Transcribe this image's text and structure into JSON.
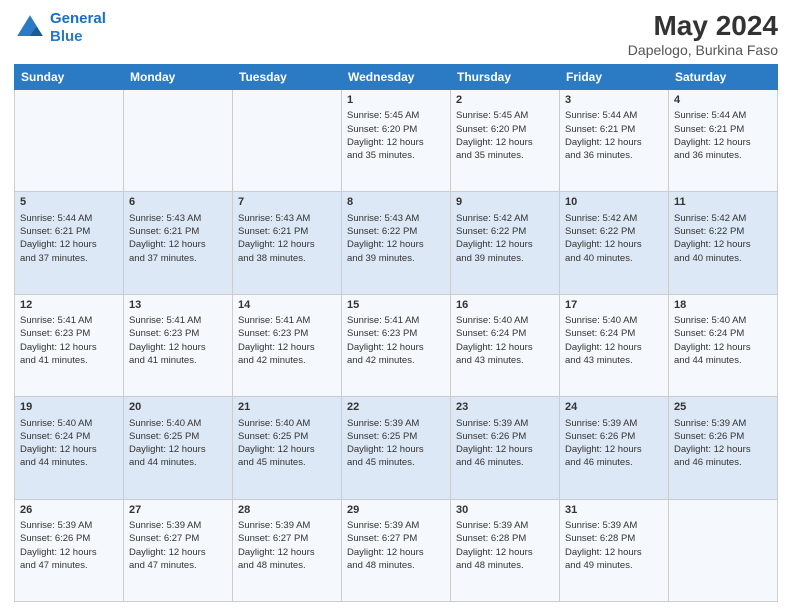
{
  "logo": {
    "line1": "General",
    "line2": "Blue"
  },
  "title": "May 2024",
  "subtitle": "Dapelogo, Burkina Faso",
  "columns": [
    "Sunday",
    "Monday",
    "Tuesday",
    "Wednesday",
    "Thursday",
    "Friday",
    "Saturday"
  ],
  "weeks": [
    [
      {
        "day": "",
        "info": ""
      },
      {
        "day": "",
        "info": ""
      },
      {
        "day": "",
        "info": ""
      },
      {
        "day": "1",
        "info": "Sunrise: 5:45 AM\nSunset: 6:20 PM\nDaylight: 12 hours\nand 35 minutes."
      },
      {
        "day": "2",
        "info": "Sunrise: 5:45 AM\nSunset: 6:20 PM\nDaylight: 12 hours\nand 35 minutes."
      },
      {
        "day": "3",
        "info": "Sunrise: 5:44 AM\nSunset: 6:21 PM\nDaylight: 12 hours\nand 36 minutes."
      },
      {
        "day": "4",
        "info": "Sunrise: 5:44 AM\nSunset: 6:21 PM\nDaylight: 12 hours\nand 36 minutes."
      }
    ],
    [
      {
        "day": "5",
        "info": "Sunrise: 5:44 AM\nSunset: 6:21 PM\nDaylight: 12 hours\nand 37 minutes."
      },
      {
        "day": "6",
        "info": "Sunrise: 5:43 AM\nSunset: 6:21 PM\nDaylight: 12 hours\nand 37 minutes."
      },
      {
        "day": "7",
        "info": "Sunrise: 5:43 AM\nSunset: 6:21 PM\nDaylight: 12 hours\nand 38 minutes."
      },
      {
        "day": "8",
        "info": "Sunrise: 5:43 AM\nSunset: 6:22 PM\nDaylight: 12 hours\nand 39 minutes."
      },
      {
        "day": "9",
        "info": "Sunrise: 5:42 AM\nSunset: 6:22 PM\nDaylight: 12 hours\nand 39 minutes."
      },
      {
        "day": "10",
        "info": "Sunrise: 5:42 AM\nSunset: 6:22 PM\nDaylight: 12 hours\nand 40 minutes."
      },
      {
        "day": "11",
        "info": "Sunrise: 5:42 AM\nSunset: 6:22 PM\nDaylight: 12 hours\nand 40 minutes."
      }
    ],
    [
      {
        "day": "12",
        "info": "Sunrise: 5:41 AM\nSunset: 6:23 PM\nDaylight: 12 hours\nand 41 minutes."
      },
      {
        "day": "13",
        "info": "Sunrise: 5:41 AM\nSunset: 6:23 PM\nDaylight: 12 hours\nand 41 minutes."
      },
      {
        "day": "14",
        "info": "Sunrise: 5:41 AM\nSunset: 6:23 PM\nDaylight: 12 hours\nand 42 minutes."
      },
      {
        "day": "15",
        "info": "Sunrise: 5:41 AM\nSunset: 6:23 PM\nDaylight: 12 hours\nand 42 minutes."
      },
      {
        "day": "16",
        "info": "Sunrise: 5:40 AM\nSunset: 6:24 PM\nDaylight: 12 hours\nand 43 minutes."
      },
      {
        "day": "17",
        "info": "Sunrise: 5:40 AM\nSunset: 6:24 PM\nDaylight: 12 hours\nand 43 minutes."
      },
      {
        "day": "18",
        "info": "Sunrise: 5:40 AM\nSunset: 6:24 PM\nDaylight: 12 hours\nand 44 minutes."
      }
    ],
    [
      {
        "day": "19",
        "info": "Sunrise: 5:40 AM\nSunset: 6:24 PM\nDaylight: 12 hours\nand 44 minutes."
      },
      {
        "day": "20",
        "info": "Sunrise: 5:40 AM\nSunset: 6:25 PM\nDaylight: 12 hours\nand 44 minutes."
      },
      {
        "day": "21",
        "info": "Sunrise: 5:40 AM\nSunset: 6:25 PM\nDaylight: 12 hours\nand 45 minutes."
      },
      {
        "day": "22",
        "info": "Sunrise: 5:39 AM\nSunset: 6:25 PM\nDaylight: 12 hours\nand 45 minutes."
      },
      {
        "day": "23",
        "info": "Sunrise: 5:39 AM\nSunset: 6:26 PM\nDaylight: 12 hours\nand 46 minutes."
      },
      {
        "day": "24",
        "info": "Sunrise: 5:39 AM\nSunset: 6:26 PM\nDaylight: 12 hours\nand 46 minutes."
      },
      {
        "day": "25",
        "info": "Sunrise: 5:39 AM\nSunset: 6:26 PM\nDaylight: 12 hours\nand 46 minutes."
      }
    ],
    [
      {
        "day": "26",
        "info": "Sunrise: 5:39 AM\nSunset: 6:26 PM\nDaylight: 12 hours\nand 47 minutes."
      },
      {
        "day": "27",
        "info": "Sunrise: 5:39 AM\nSunset: 6:27 PM\nDaylight: 12 hours\nand 47 minutes."
      },
      {
        "day": "28",
        "info": "Sunrise: 5:39 AM\nSunset: 6:27 PM\nDaylight: 12 hours\nand 48 minutes."
      },
      {
        "day": "29",
        "info": "Sunrise: 5:39 AM\nSunset: 6:27 PM\nDaylight: 12 hours\nand 48 minutes."
      },
      {
        "day": "30",
        "info": "Sunrise: 5:39 AM\nSunset: 6:28 PM\nDaylight: 12 hours\nand 48 minutes."
      },
      {
        "day": "31",
        "info": "Sunrise: 5:39 AM\nSunset: 6:28 PM\nDaylight: 12 hours\nand 49 minutes."
      },
      {
        "day": "",
        "info": ""
      }
    ]
  ]
}
